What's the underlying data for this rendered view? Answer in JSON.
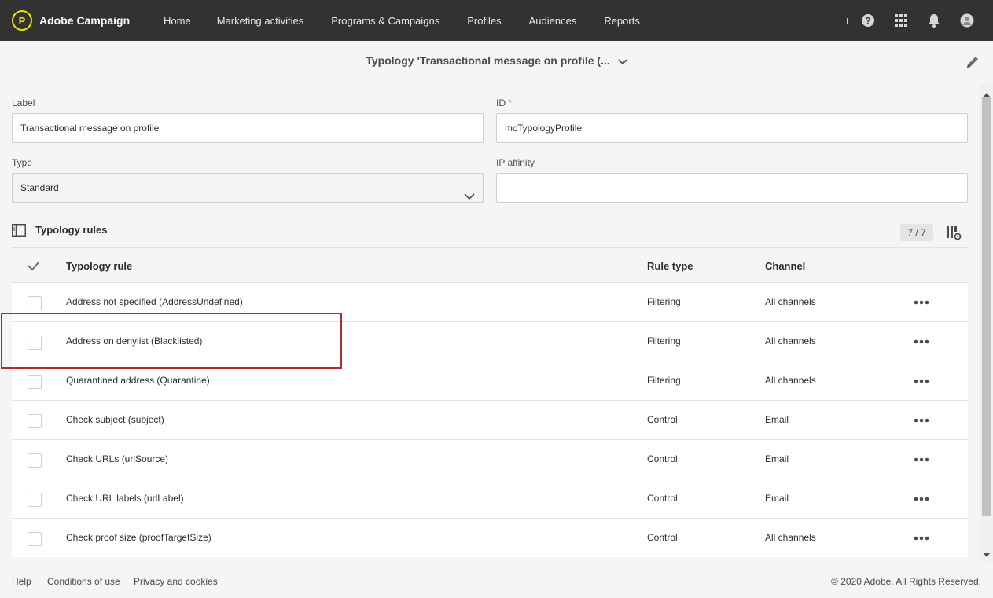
{
  "brand": {
    "name": "Adobe Campaign",
    "logo_icon": "adobe-campaign-logo-icon",
    "logo_glyph": "P"
  },
  "nav": {
    "items": [
      "Home",
      "Marketing activities",
      "Programs & Campaigns",
      "Profiles",
      "Audiences",
      "Reports"
    ]
  },
  "top_icons": [
    "help-icon",
    "apps-grid-icon",
    "notifications-bell-icon",
    "user-avatar-icon"
  ],
  "header": {
    "title": "Typology 'Transactional message on profile (...",
    "edit_icon": "pencil-icon"
  },
  "form": {
    "label": {
      "label": "Label",
      "value": "Transactional message on profile"
    },
    "id": {
      "label": "ID",
      "required_mark": "*",
      "value": "mcTypologyProfile"
    },
    "type": {
      "label": "Type",
      "value": "Standard"
    },
    "ip_affinity": {
      "label": "IP affinity",
      "value": ""
    }
  },
  "rules": {
    "title": "Typology rules",
    "count": "7 / 7",
    "columns": [
      "Typology rule",
      "Rule type",
      "Channel"
    ],
    "rows": [
      {
        "rule": "Address not specified (AddressUndefined)",
        "type": "Filtering",
        "channel": "All channels"
      },
      {
        "rule": "Address on denylist (Blacklisted)",
        "type": "Filtering",
        "channel": "All channels"
      },
      {
        "rule": "Quarantined address (Quarantine)",
        "type": "Filtering",
        "channel": "All channels"
      },
      {
        "rule": "Check subject (subject)",
        "type": "Control",
        "channel": "Email"
      },
      {
        "rule": "Check URLs (urlSource)",
        "type": "Control",
        "channel": "Email"
      },
      {
        "rule": "Check URL labels (urlLabel)",
        "type": "Control",
        "channel": "Email"
      },
      {
        "rule": "Check proof size (proofTargetSize)",
        "type": "Control",
        "channel": "All channels"
      }
    ]
  },
  "footer": {
    "links": [
      "Help",
      "Conditions of use",
      "Privacy and cookies"
    ],
    "copyright": "© 2020 Adobe. All Rights Reserved."
  },
  "colors": {
    "topbar": "#323232",
    "brand_accent": "#e6e300",
    "highlight": "#b42a2a",
    "required": "#e68619"
  }
}
